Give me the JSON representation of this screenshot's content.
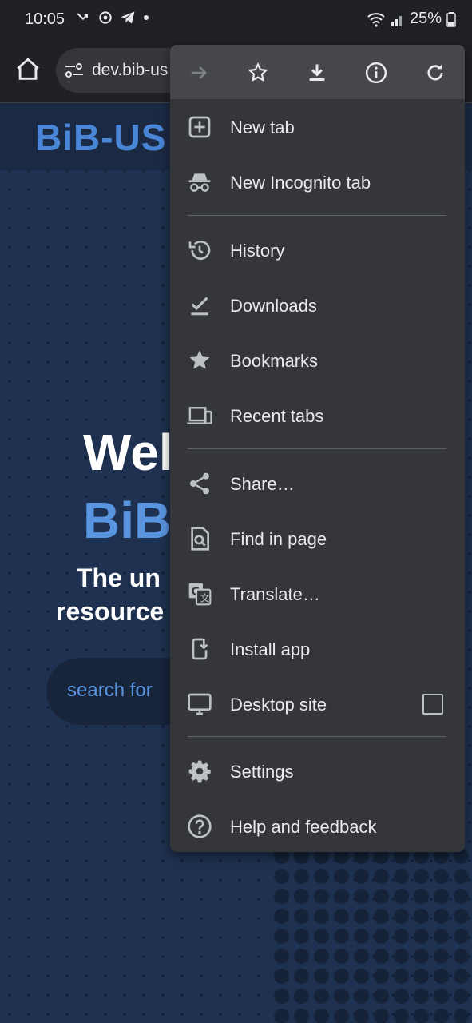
{
  "status_bar": {
    "time": "10:05",
    "battery": "25%"
  },
  "toolbar": {
    "url": "dev.bib-us"
  },
  "page": {
    "logo": "BiB-US",
    "hero_line1": "Wel",
    "hero_line2": "BiB",
    "tagline_line1": "The un",
    "tagline_line2": "resource",
    "search_placeholder": "search for"
  },
  "menu": {
    "top_icons": [
      "forward-icon",
      "star-icon",
      "download-icon",
      "info-icon",
      "refresh-icon"
    ],
    "items": [
      {
        "label": "New tab",
        "icon": "new-tab-icon"
      },
      {
        "label": "New Incognito tab",
        "icon": "incognito-icon"
      },
      {
        "label": "History",
        "icon": "history-icon"
      },
      {
        "label": "Downloads",
        "icon": "downloads-icon"
      },
      {
        "label": "Bookmarks",
        "icon": "bookmarks-icon"
      },
      {
        "label": "Recent tabs",
        "icon": "recent-tabs-icon"
      },
      {
        "label": "Share…",
        "icon": "share-icon"
      },
      {
        "label": "Find in page",
        "icon": "find-in-page-icon"
      },
      {
        "label": "Translate…",
        "icon": "translate-icon"
      },
      {
        "label": "Install app",
        "icon": "install-app-icon"
      },
      {
        "label": "Desktop site",
        "icon": "desktop-site-icon",
        "checked": false
      },
      {
        "label": "Settings",
        "icon": "settings-icon"
      },
      {
        "label": "Help and feedback",
        "icon": "help-icon"
      }
    ]
  }
}
